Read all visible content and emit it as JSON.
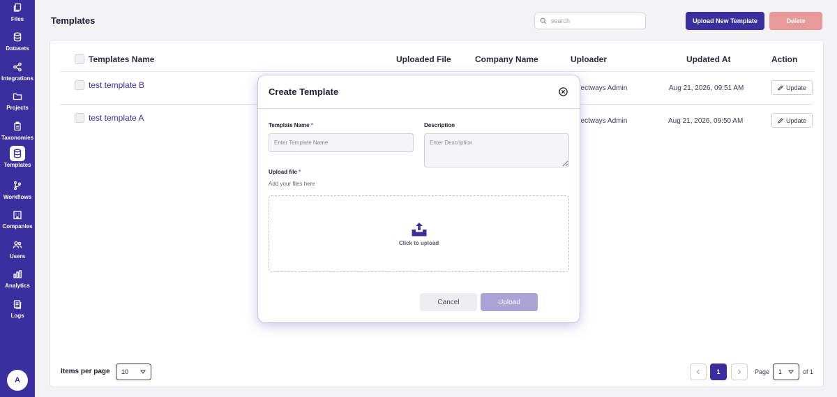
{
  "sidebar": {
    "items": [
      {
        "label": "Files",
        "icon": "files-icon"
      },
      {
        "label": "Datasets",
        "icon": "database-icon"
      },
      {
        "label": "Integrations",
        "icon": "share-icon"
      },
      {
        "label": "Projects",
        "icon": "folder-icon"
      },
      {
        "label": "Taxonomies",
        "icon": "clipboard-icon"
      },
      {
        "label": "Templates",
        "icon": "template-icon",
        "active": true
      },
      {
        "label": "Workflows",
        "icon": "branch-icon"
      },
      {
        "label": "Companies",
        "icon": "building-icon"
      },
      {
        "label": "Users",
        "icon": "users-icon"
      },
      {
        "label": "Analytics",
        "icon": "bar-chart-icon"
      },
      {
        "label": "Logs",
        "icon": "logs-icon"
      }
    ],
    "avatar_initial": "A"
  },
  "header": {
    "title": "Templates",
    "search_placeholder": "search",
    "upload_new_label": "Upload New Template",
    "delete_label": "Delete"
  },
  "table": {
    "columns": [
      "Templates Name",
      "Uploaded File",
      "Company Name",
      "Uploader",
      "Updated At",
      "Action"
    ],
    "rows": [
      {
        "name": "test template B",
        "uploader": "Objectways Admin",
        "updated_at": "Aug 21, 2026, 09:51 AM",
        "action": "Update"
      },
      {
        "name": "test template A",
        "uploader": "Objectways Admin",
        "updated_at": "Aug 21, 2026, 09:50 AM",
        "action": "Update"
      }
    ]
  },
  "pagination": {
    "items_per_page_label": "Items per page",
    "items_per_page_value": "10",
    "current_page": "1",
    "page_label": "Page",
    "page_select_value": "1",
    "of_label": "of 1"
  },
  "modal": {
    "title": "Create Template",
    "template_name_label": "Template Name",
    "template_name_placeholder": "Enter Template Name",
    "description_label": "Description",
    "description_placeholder": "Enter Description",
    "upload_file_label": "Upload file",
    "required_mark": "*",
    "upload_hint": "Add your files here",
    "dropzone_text": "Click to upload",
    "cancel_label": "Cancel",
    "upload_label": "Upload"
  },
  "colors": {
    "primary": "#3b2fa0",
    "delete": "#e89a9a",
    "upload_disabled": "#a9a3d6",
    "required": "#e04848"
  }
}
